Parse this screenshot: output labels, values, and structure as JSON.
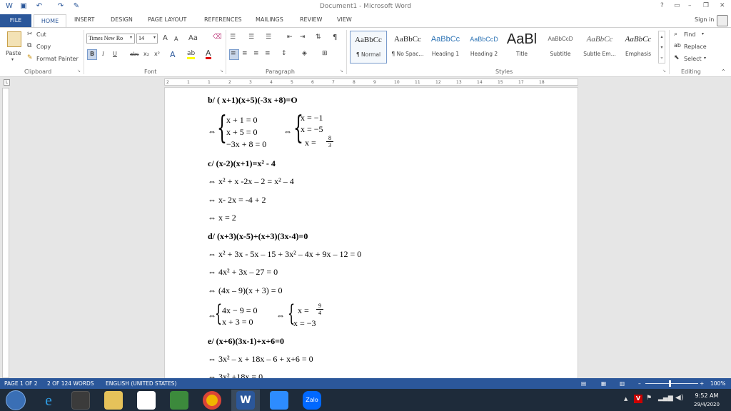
{
  "app": {
    "title": "Document1 - Microsoft Word",
    "help": "?",
    "sign_in": "Sign in"
  },
  "tabs": [
    "FILE",
    "HOME",
    "INSERT",
    "DESIGN",
    "PAGE LAYOUT",
    "REFERENCES",
    "MAILINGS",
    "REVIEW",
    "VIEW"
  ],
  "clipboard": {
    "cut": "Cut",
    "copy": "Copy",
    "format_painter": "Format Painter",
    "paste": "Paste",
    "label": "Clipboard"
  },
  "font": {
    "name": "Times New Ro",
    "size": "14",
    "label": "Font",
    "bold": "B",
    "italic": "I",
    "underline": "U",
    "strike": "abc",
    "sub": "x₂",
    "sup": "x²",
    "grow": "A",
    "shrink": "A",
    "case": "Aa"
  },
  "paragraph": {
    "label": "Paragraph",
    "pilcrow": "¶"
  },
  "styles": {
    "label": "Styles",
    "items": [
      {
        "preview": "AaBbCc",
        "name": "¶ Normal"
      },
      {
        "preview": "AaBbCc",
        "name": "¶ No Spac..."
      },
      {
        "preview": "AaBbCc",
        "name": "Heading 1"
      },
      {
        "preview": "AaBbCcD",
        "name": "Heading 2"
      },
      {
        "preview": "AaBl",
        "name": "Title"
      },
      {
        "preview": "AaBbCcD",
        "name": "Subtitle"
      },
      {
        "preview": "AaBbCc",
        "name": "Subtle Em..."
      },
      {
        "preview": "AaBbCc",
        "name": "Emphasis"
      }
    ]
  },
  "editing": {
    "find": "Find",
    "replace": "Replace",
    "select": "Select",
    "label": "Editing"
  },
  "ruler": [
    "2",
    "1",
    "1",
    "2",
    "3",
    "4",
    "5",
    "6",
    "7",
    "8",
    "9",
    "10",
    "11",
    "12",
    "13",
    "14",
    "15",
    "17",
    "18"
  ],
  "doc": {
    "b_title": "b/ ( x+1)(x+5)(-3x +8)=O",
    "b_sys1": [
      "x + 1 = 0",
      "x + 5 = 0",
      "−3x + 8 = 0"
    ],
    "b_sys2": [
      "x =  −1",
      "x =  −5",
      "x = "
    ],
    "b_frac": {
      "num": "8",
      "den": "3"
    },
    "arrow": "⇔",
    "c_title": "c/ (x-2)(x+1)=x² - 4",
    "c1": "⇔ x² + x -2x – 2 = x² – 4",
    "c2": "⇔ x- 2x = -4 + 2",
    "c3": "⇔ x = 2",
    "d_title": "d/ (x+3)(x-5)+(x+3)(3x-4)=0",
    "d1": "⇔ x² + 3x - 5x – 15 + 3x² – 4x + 9x – 12 = 0",
    "d2": "⇔ 4x² + 3x – 27 = 0",
    "d3": "⇔ (4x – 9)(x + 3) = 0",
    "d_sys1": [
      "4x −  9 = 0",
      "x + 3 = 0"
    ],
    "d_sys2": [
      "x = ",
      "x =  −3"
    ],
    "d_frac": {
      "num": "9",
      "den": "4"
    },
    "e_title": "e/ (x+6)(3x-1)+x+6=0",
    "e1": "⇔ 3x² – x + 18x – 6 + x+6 = 0",
    "e2": "⇔ 3x² +18x = 0"
  },
  "status": {
    "page": "PAGE 1 OF 2",
    "words": "2 OF 124 WORDS",
    "lang": "ENGLISH (UNITED STATES)",
    "zoom": "100%"
  },
  "clock": {
    "time": "9:52 AM",
    "date": "29/4/2020"
  },
  "taskbar": {
    "zalo": "Zalo"
  },
  "colors": {
    "accent": "#2b579a",
    "taskbar": "#1e2b3a"
  }
}
